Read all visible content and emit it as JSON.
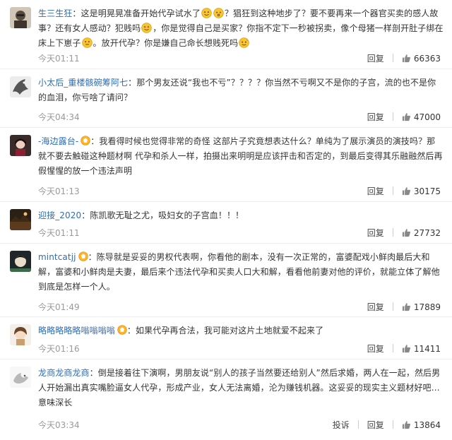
{
  "comments": [
    {
      "username": "生三生狂",
      "text_parts": [
        "这是明晃晃准备开始代孕试水了",
        "？猖狂到这种地步了？要不要再来一个器官买卖的感人故事？还有女人感动？犯贱吗",
        "，你是觉得自己是买家？你指不定下一秒被拐卖，像个母猪一样剖开肚子绑在床上下崽子",
        "。放开代孕？你是嫌自己命长想贱死吗"
      ],
      "timestamp": "今天01:11",
      "reply_label": "回复",
      "like_count": "66363"
    },
    {
      "username": "小太后_重楼骸碗筹阿七",
      "text": "那个男友还说“我也不亏”？？？？你当然不亏啊又不是你的子宫，流的也不是你的血泪，你亏啥了请问？",
      "timestamp": "今天04:34",
      "reply_label": "回复",
      "like_count": "47000"
    },
    {
      "username": "-海边露台-",
      "text": "我看得时候也觉得非常的奇怪 这部片子究竟想表达什么？单纯为了展示演员的演技吗？那就不要去触碰这种题材啊 代孕和杀人一样，拍摄出来明明是应该抨击和否定的，到最后变得其乐融融然后再假惺惺的放一个违法声明",
      "timestamp": "今天01:13",
      "reply_label": "回复",
      "like_count": "30175"
    },
    {
      "username": "迎接_2020",
      "text": "陈凯歌无耻之尤，吸妇女的子宫血！！！",
      "timestamp": "今天01:11",
      "reply_label": "回复",
      "like_count": "27732"
    },
    {
      "username": "mintcatjj",
      "text": "陈导就是妥妥的男权代表啊，你看他的剧本，没有一次正常的，富婆配戏小鲜肉最后大和解，富婆和小鲜肉是夫妻，最后来个违法代孕和买卖人口大和解，看看他前妻对他的评价，就能立体了解他到底是怎样一个人。",
      "timestamp": "今天01:49",
      "reply_label": "回复",
      "like_count": "17889"
    },
    {
      "username": "略略略略略嗡嗡嗡嗡",
      "text": "如果代孕再合法，我可能对这片土地就爱不起来了",
      "timestamp": "今天01:16",
      "reply_label": "回复",
      "like_count": "11411"
    },
    {
      "username": "龙商龙商龙商",
      "text": "倒是接着往下演啊，男朋友说“别人的孩子当然要还给别人”然后求婚，两人在一起，然后男人开始漏出真实嘴脸逼女人代孕，形成产业，女人无法离婚，沦为赚钱机器。这妥妥的现实主义题材好吧…意味深长",
      "timestamp": "今天03:34",
      "report_label": "投诉",
      "reply_label": "回复",
      "like_count": "13864"
    }
  ],
  "colors": {
    "username": "#2d6db8",
    "text": "#333333",
    "timestamp": "#9a9a9a"
  },
  "icons": {
    "like": "thumbs-up-icon",
    "emoji": "smile-emoji-icon",
    "badge": "member-badge-icon"
  }
}
